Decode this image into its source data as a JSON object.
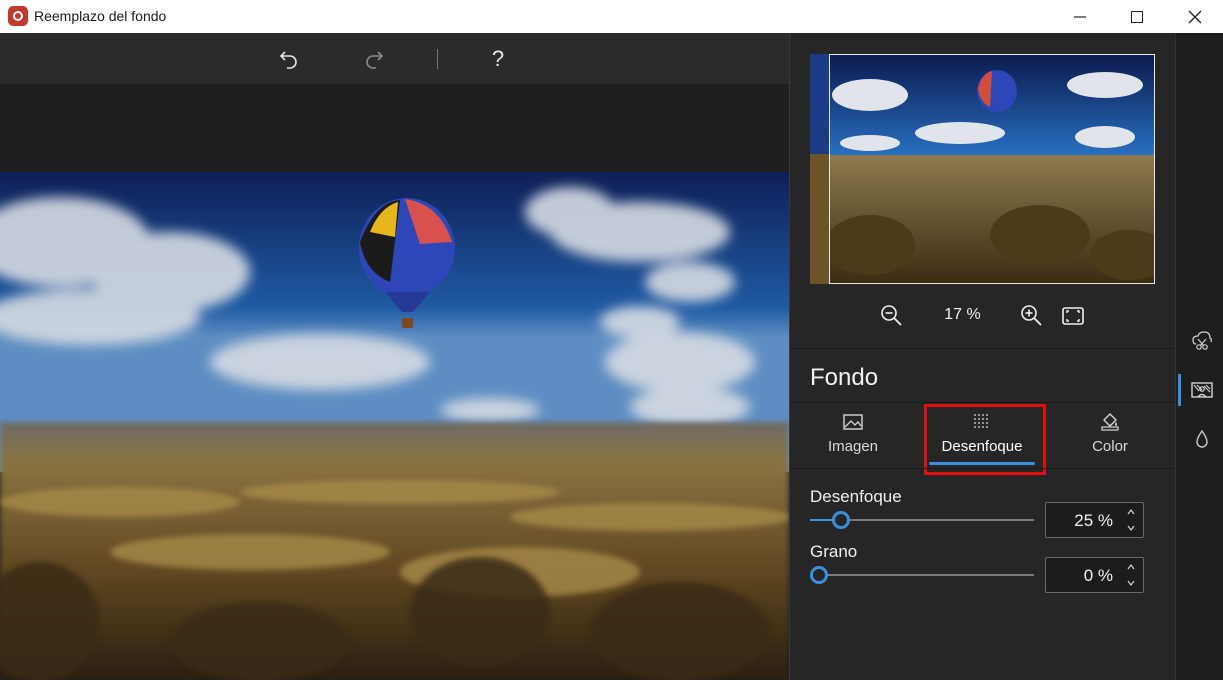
{
  "window": {
    "title": "Reemplazo del fondo"
  },
  "toolbar": {
    "undo_icon": "undo-icon",
    "redo_icon": "redo-icon",
    "help_label": "?"
  },
  "preview": {
    "zoom_value": "17 %"
  },
  "panel": {
    "section_title": "Fondo",
    "tabs": [
      {
        "label": "Imagen",
        "icon": "image-icon"
      },
      {
        "label": "Desenfoque",
        "icon": "blur-grid-icon",
        "active": true
      },
      {
        "label": "Color",
        "icon": "paint-bucket-icon"
      }
    ],
    "blur": {
      "label": "Desenfoque",
      "value_text": "25 %",
      "value": 25
    },
    "grain": {
      "label": "Grano",
      "value_text": "0 %",
      "value": 0
    }
  },
  "colors": {
    "accent": "#3a8fe0",
    "highlight": "#e10f0f",
    "panel_bg": "#262626"
  }
}
